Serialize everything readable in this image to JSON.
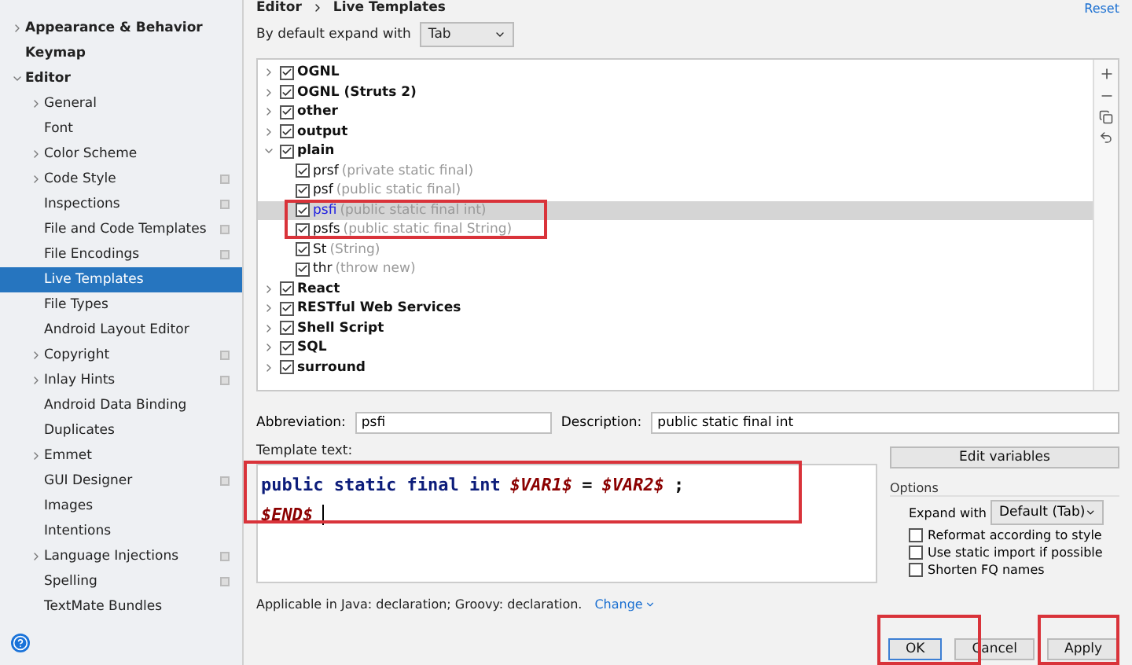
{
  "sidebar": {
    "items": [
      {
        "label": "Appearance & Behavior",
        "expandable": true,
        "expanded": false,
        "selected": false
      },
      {
        "label": "Keymap",
        "expandable": false,
        "selected": false
      },
      {
        "label": "Editor",
        "expandable": true,
        "expanded": true,
        "selected": false,
        "children": [
          {
            "label": "General",
            "expandable": true,
            "expanded": false,
            "selected": false
          },
          {
            "label": "Font",
            "expandable": false,
            "selected": false
          },
          {
            "label": "Color Scheme",
            "expandable": true,
            "expanded": false,
            "selected": false
          },
          {
            "label": "Code Style",
            "expandable": true,
            "expanded": false,
            "selected": false,
            "badge": true
          },
          {
            "label": "Inspections",
            "expandable": false,
            "selected": false,
            "badge": true
          },
          {
            "label": "File and Code Templates",
            "expandable": false,
            "selected": false,
            "badge": true
          },
          {
            "label": "File Encodings",
            "expandable": false,
            "selected": false,
            "badge": true
          },
          {
            "label": "Live Templates",
            "expandable": false,
            "selected": true
          },
          {
            "label": "File Types",
            "expandable": false,
            "selected": false
          },
          {
            "label": "Android Layout Editor",
            "expandable": false,
            "selected": false
          },
          {
            "label": "Copyright",
            "expandable": true,
            "expanded": false,
            "selected": false,
            "badge": true
          },
          {
            "label": "Inlay Hints",
            "expandable": true,
            "expanded": false,
            "selected": false,
            "badge": true
          },
          {
            "label": "Android Data Binding",
            "expandable": false,
            "selected": false
          },
          {
            "label": "Duplicates",
            "expandable": false,
            "selected": false
          },
          {
            "label": "Emmet",
            "expandable": true,
            "expanded": false,
            "selected": false
          },
          {
            "label": "GUI Designer",
            "expandable": false,
            "selected": false,
            "badge": true
          },
          {
            "label": "Images",
            "expandable": false,
            "selected": false
          },
          {
            "label": "Intentions",
            "expandable": false,
            "selected": false
          },
          {
            "label": "Language Injections",
            "expandable": true,
            "expanded": false,
            "selected": false,
            "badge": true
          },
          {
            "label": "Spelling",
            "expandable": false,
            "selected": false,
            "badge": true
          },
          {
            "label": "TextMate Bundles",
            "expandable": false,
            "selected": false
          }
        ]
      }
    ]
  },
  "breadcrumb": [
    "Editor",
    "Live Templates"
  ],
  "reset_link": "Reset",
  "expand_setting": {
    "label": "By default expand with",
    "value": "Tab"
  },
  "template_tree": [
    {
      "kind": "group",
      "label": "OGNL",
      "checked": true,
      "expanded": false,
      "selected": false
    },
    {
      "kind": "group",
      "label": "OGNL (Struts 2)",
      "checked": true,
      "expanded": false,
      "selected": false
    },
    {
      "kind": "group",
      "label": "other",
      "checked": true,
      "expanded": false,
      "selected": false
    },
    {
      "kind": "group",
      "label": "output",
      "checked": true,
      "expanded": false,
      "selected": false
    },
    {
      "kind": "group",
      "label": "plain",
      "checked": true,
      "expanded": true,
      "selected": false,
      "children": [
        {
          "kind": "template",
          "label": "prsf",
          "description": "(private static final)",
          "checked": true,
          "selected": false
        },
        {
          "kind": "template",
          "label": "psf",
          "description": "(public static final)",
          "checked": true,
          "selected": false
        },
        {
          "kind": "template",
          "label": "psfi",
          "description": "(public static final int)",
          "checked": true,
          "selected": true
        },
        {
          "kind": "template",
          "label": "psfs",
          "description": "(public static final String)",
          "checked": true,
          "selected": false
        },
        {
          "kind": "template",
          "label": "St",
          "description": "(String)",
          "checked": true,
          "selected": false
        },
        {
          "kind": "template",
          "label": "thr",
          "description": "(throw new)",
          "checked": true,
          "selected": false
        }
      ]
    },
    {
      "kind": "group",
      "label": "React",
      "checked": true,
      "expanded": false,
      "selected": false
    },
    {
      "kind": "group",
      "label": "RESTful Web Services",
      "checked": true,
      "expanded": false,
      "selected": false
    },
    {
      "kind": "group",
      "label": "Shell Script",
      "checked": true,
      "expanded": false,
      "selected": false
    },
    {
      "kind": "group",
      "label": "SQL",
      "checked": true,
      "expanded": false,
      "selected": false
    },
    {
      "kind": "group",
      "label": "surround",
      "checked": true,
      "expanded": false,
      "selected": false
    }
  ],
  "abbreviation": {
    "label": "Abbreviation:",
    "value": "psfi"
  },
  "description": {
    "label": "Description:",
    "value": "public static final int"
  },
  "template_text": {
    "label": "Template text:",
    "lines": [
      [
        {
          "kind": "keyword",
          "text": "public static final int"
        },
        {
          "kind": "variable",
          "text": "$VAR1$"
        },
        {
          "kind": "plain",
          "text": "="
        },
        {
          "kind": "variable",
          "text": "$VAR2$"
        },
        {
          "kind": "plain",
          "text": ";"
        }
      ],
      [
        {
          "kind": "variable",
          "text": "$END$"
        }
      ]
    ]
  },
  "edit_variables_button": "Edit variables",
  "options": {
    "title": "Options",
    "expand_label": "Expand with",
    "expand_value": "Default (Tab)",
    "checkboxes": [
      {
        "label": "Reformat according to style",
        "checked": false
      },
      {
        "label": "Use static import if possible",
        "checked": false
      },
      {
        "label": "Shorten FQ names",
        "checked": false
      }
    ]
  },
  "applicable": {
    "text": "Applicable in Java: declaration; Groovy: declaration.",
    "link": "Change"
  },
  "buttons": [
    {
      "label": "OK",
      "default": true
    },
    {
      "label": "Cancel",
      "default": false
    },
    {
      "label": "Apply",
      "default": false
    }
  ]
}
